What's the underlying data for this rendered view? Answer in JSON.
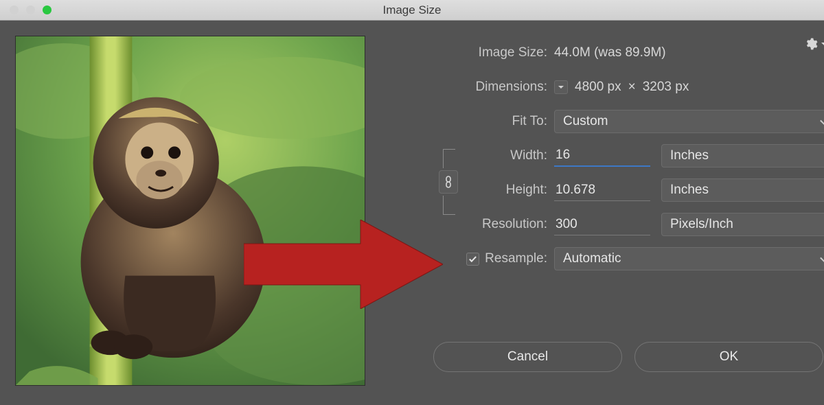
{
  "window": {
    "title": "Image Size"
  },
  "labels": {
    "image_size": "Image Size:",
    "dimensions": "Dimensions:",
    "fit_to": "Fit To:",
    "width": "Width:",
    "height": "Height:",
    "resolution": "Resolution:",
    "resample": "Resample:"
  },
  "values": {
    "image_size": "44.0M (was 89.9M)",
    "dim_w": "4800 px",
    "dim_x": "×",
    "dim_h": "3203 px",
    "fit_to": "Custom",
    "width": "16",
    "width_unit": "Inches",
    "height": "10.678",
    "height_unit": "Inches",
    "resolution": "300",
    "resolution_unit": "Pixels/Inch",
    "resample_checked": true,
    "resample_mode": "Automatic"
  },
  "buttons": {
    "cancel": "Cancel",
    "ok": "OK"
  },
  "colors": {
    "arrow": "#b72220",
    "panel": "#535353",
    "focus": "#3d78c6"
  }
}
